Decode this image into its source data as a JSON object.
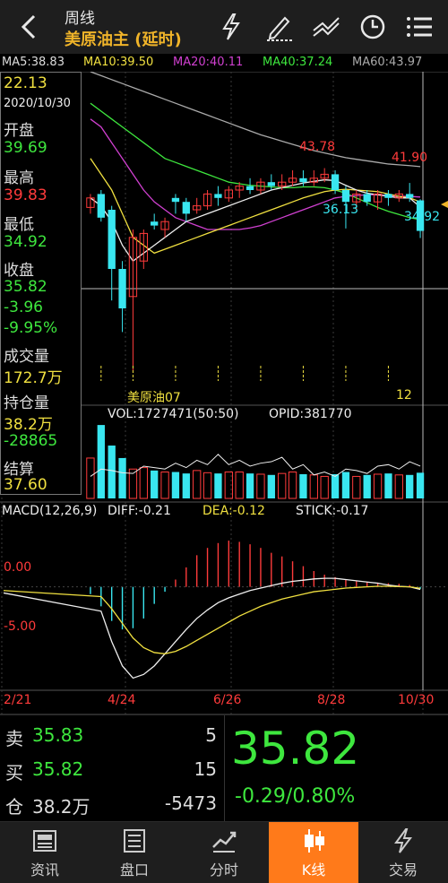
{
  "header": {
    "period": "周线",
    "instrument": "美原油主 (延时)",
    "icons": [
      "lightning-icon",
      "draw-pen-icon",
      "indicator-icon",
      "clock-icon",
      "menu-icon"
    ]
  },
  "ma_line": {
    "items": [
      {
        "text": "MA5:38.83",
        "color": "#dddddd"
      },
      {
        "text": "MA10:39.50",
        "color": "#f0e040"
      },
      {
        "text": "MA20:40.11",
        "color": "#d040d0"
      },
      {
        "text": "MA40:37.24",
        "color": "#3ee73e"
      },
      {
        "text": "MA60:43.97",
        "color": "#aaaaaa"
      }
    ]
  },
  "info_panel": {
    "value_top": "22.13",
    "date": "2020/10/30",
    "open_label": "开盘",
    "open": "39.69",
    "high_label": "最高",
    "high": "39.83",
    "low_label": "最低",
    "low": "34.92",
    "close_label": "收盘",
    "close": "35.82",
    "change": "-3.96",
    "change_pct": "-9.95%",
    "volume_label": "成交量",
    "volume": "172.7万",
    "oi_label": "持仓量",
    "oi": "38.2万",
    "oi_change": "-28865",
    "settle_label": "结算",
    "settle": "37.60"
  },
  "chart_labels": {
    "peak1": "43.78",
    "peak2": "41.90",
    "trough1": "36.13",
    "last_low": "34.92",
    "contract_label": "美原油07",
    "month_mark": "12"
  },
  "volume_line": {
    "vol": "VOL:1727471(50:50)",
    "opid": "OPID:381770"
  },
  "macd_line": {
    "title": "MACD(12,26,9)",
    "diff": "DIFF:-0.21",
    "dea": "DEA:-0.12",
    "stick": "STICK:-0.17",
    "zero": "0.00",
    "minus5": "-5.00"
  },
  "x_axis": [
    "2/21",
    "4/24",
    "6/26",
    "8/28",
    "10/30"
  ],
  "chart_data": {
    "type": "candlestick",
    "candles": [
      {
        "o": 38.8,
        "c": 40.0,
        "h": 40.5,
        "l": 38.0
      },
      {
        "o": 40.5,
        "c": 37.5,
        "h": 41.0,
        "l": 37.0
      },
      {
        "o": 38.5,
        "c": 31.0,
        "h": 39.0,
        "l": 27.0
      },
      {
        "o": 31.0,
        "c": 26.0,
        "h": 32.0,
        "l": 23.0
      },
      {
        "o": 27.5,
        "c": 35.0,
        "h": 36.0,
        "l": 18.0
      },
      {
        "o": 32.0,
        "c": 35.5,
        "h": 36.0,
        "l": 31.0
      },
      {
        "o": 37.0,
        "c": 36.5,
        "h": 38.0,
        "l": 36.0
      },
      {
        "o": 36.0,
        "c": 37.0,
        "h": 37.5,
        "l": 35.0
      },
      {
        "o": 40.0,
        "c": 39.5,
        "h": 40.5,
        "l": 38.0
      },
      {
        "o": 39.5,
        "c": 38.0,
        "h": 40.0,
        "l": 37.0
      },
      {
        "o": 38.5,
        "c": 39.0,
        "h": 40.0,
        "l": 38.0
      },
      {
        "o": 39.0,
        "c": 40.5,
        "h": 41.0,
        "l": 38.5
      },
      {
        "o": 40.5,
        "c": 40.0,
        "h": 41.5,
        "l": 39.0
      },
      {
        "o": 40.0,
        "c": 41.0,
        "h": 41.5,
        "l": 39.5
      },
      {
        "o": 41.0,
        "c": 41.5,
        "h": 42.0,
        "l": 40.0
      },
      {
        "o": 41.5,
        "c": 41.0,
        "h": 42.5,
        "l": 40.5
      },
      {
        "o": 41.0,
        "c": 42.0,
        "h": 42.5,
        "l": 40.5
      },
      {
        "o": 42.0,
        "c": 41.5,
        "h": 43.0,
        "l": 41.0
      },
      {
        "o": 41.5,
        "c": 42.0,
        "h": 43.0,
        "l": 41.0
      },
      {
        "o": 42.0,
        "c": 42.5,
        "h": 43.5,
        "l": 41.5
      },
      {
        "o": 42.5,
        "c": 42.0,
        "h": 43.5,
        "l": 41.5
      },
      {
        "o": 42.0,
        "c": 42.5,
        "h": 43.5,
        "l": 41.5
      },
      {
        "o": 42.5,
        "c": 43.0,
        "h": 43.78,
        "l": 42.0
      },
      {
        "o": 43.0,
        "c": 41.0,
        "h": 43.5,
        "l": 40.5
      },
      {
        "o": 41.0,
        "c": 39.5,
        "h": 41.5,
        "l": 36.13
      },
      {
        "o": 39.5,
        "c": 40.5,
        "h": 41.0,
        "l": 38.5
      },
      {
        "o": 40.5,
        "c": 39.5,
        "h": 41.0,
        "l": 39.0
      },
      {
        "o": 39.5,
        "c": 40.5,
        "h": 41.0,
        "l": 38.5
      },
      {
        "o": 40.5,
        "c": 40.0,
        "h": 41.0,
        "l": 39.0
      },
      {
        "o": 40.0,
        "c": 40.5,
        "h": 41.0,
        "l": 39.5
      },
      {
        "o": 40.5,
        "c": 40.0,
        "h": 41.9,
        "l": 39.5
      },
      {
        "o": 39.69,
        "c": 35.82,
        "h": 39.83,
        "l": 34.92
      }
    ],
    "ma5": [
      40,
      39,
      37,
      34,
      32,
      33,
      34,
      35,
      36,
      37,
      37.5,
      38,
      38.5,
      39,
      39.5,
      40,
      40.5,
      41,
      41.3,
      41.6,
      41.9,
      42.1,
      42.3,
      42.2,
      41.6,
      41,
      40.6,
      40.4,
      40.2,
      40,
      40,
      38.83
    ],
    "ma10": [
      45,
      43,
      41,
      38,
      35,
      34,
      33,
      33.5,
      34,
      34.5,
      35,
      35.5,
      36,
      36.5,
      37,
      37.5,
      38,
      38.5,
      39,
      39.5,
      40,
      40.4,
      40.8,
      41,
      41.1,
      41,
      40.9,
      40.8,
      40.5,
      40.2,
      40,
      39.5
    ],
    "ma20": [
      50,
      49,
      47,
      45,
      43,
      41,
      39.5,
      38.5,
      37.5,
      37,
      36.5,
      36,
      36,
      36,
      36,
      36.2,
      36.5,
      37,
      37.5,
      38,
      38.5,
      39,
      39.5,
      40,
      40.2,
      40.3,
      40.4,
      40.4,
      40.3,
      40.2,
      40.2,
      40.11
    ],
    "ma40": [
      52,
      51,
      50,
      49,
      48,
      47,
      46,
      45,
      44.5,
      44,
      43.5,
      43,
      42.5,
      42,
      41.8,
      41.6,
      41.5,
      41.4,
      41.3,
      41.3,
      41.4,
      41.4,
      41.3,
      41,
      40.6,
      40,
      39.4,
      38.8,
      38.3,
      37.9,
      37.5,
      37.24
    ],
    "ma60": [
      56,
      55.5,
      55,
      54.5,
      54,
      53.5,
      53,
      52.5,
      52,
      51.5,
      51,
      50.5,
      50,
      49.5,
      49,
      48.5,
      48,
      47.6,
      47.2,
      46.8,
      46.4,
      46,
      45.7,
      45.4,
      45.1,
      44.9,
      44.7,
      44.5,
      44.3,
      44.2,
      44.1,
      43.97
    ],
    "volume": [
      55,
      100,
      72,
      55,
      40,
      42,
      38,
      36,
      36,
      34,
      38,
      35,
      34,
      36,
      36,
      34,
      33,
      32,
      34,
      36,
      33,
      32,
      30,
      33,
      36,
      30,
      32,
      33,
      34,
      32,
      32,
      35
    ],
    "oi_line": [
      30,
      40,
      38,
      35,
      34,
      44,
      42,
      40,
      48,
      42,
      52,
      46,
      60,
      46,
      52,
      44,
      48,
      50,
      56,
      40,
      46,
      32,
      36,
      30,
      40,
      38,
      34,
      44,
      46,
      40,
      50,
      44
    ],
    "macd_hist": [
      -0.6,
      -1.6,
      -2.8,
      -3.5,
      -3.4,
      -2.6,
      -1.4,
      -0.4,
      0.6,
      1.6,
      2.6,
      3.2,
      3.6,
      3.8,
      3.7,
      3.5,
      3.2,
      2.8,
      2.5,
      2.1,
      1.7,
      1.3,
      1.0,
      0.8,
      0.6,
      0.5,
      0.4,
      0.35,
      0.3,
      0.25,
      0.15,
      -0.17
    ],
    "diff": [
      -0.5,
      -2,
      -4.5,
      -6.5,
      -7.5,
      -7.2,
      -6.5,
      -5.5,
      -4.5,
      -3.5,
      -2.6,
      -1.9,
      -1.3,
      -0.9,
      -0.6,
      -0.3,
      -0.1,
      0.1,
      0.3,
      0.45,
      0.55,
      0.65,
      0.7,
      0.7,
      0.6,
      0.5,
      0.4,
      0.3,
      0.15,
      0.05,
      0,
      -0.21
    ],
    "dea": [
      -0.3,
      -0.8,
      -1.8,
      -3,
      -4.2,
      -5,
      -5.4,
      -5.5,
      -5.3,
      -4.9,
      -4.4,
      -3.9,
      -3.4,
      -2.9,
      -2.4,
      -2,
      -1.6,
      -1.3,
      -1,
      -0.8,
      -0.6,
      -0.4,
      -0.3,
      -0.2,
      -0.1,
      -0.05,
      0,
      0.05,
      0.05,
      0.02,
      0,
      -0.12
    ],
    "price_range": [
      16,
      56
    ],
    "macd_range": [
      -8.5,
      5.5
    ]
  },
  "quote": {
    "sell_label": "卖",
    "sell_price": "35.83",
    "sell_qty": "5",
    "buy_label": "买",
    "buy_price": "35.82",
    "buy_qty": "15",
    "oi_label": "仓",
    "oi_value": "38.2万",
    "oi_change": "-5473",
    "last_price": "35.82",
    "change": "-0.29/0.80%"
  },
  "tabs": [
    {
      "label": "资讯",
      "icon": "news-icon"
    },
    {
      "label": "盘口",
      "icon": "orderbook-icon"
    },
    {
      "label": "分时",
      "icon": "timeshare-icon"
    },
    {
      "label": "K线",
      "icon": "candlestick-icon",
      "active": true
    },
    {
      "label": "交易",
      "icon": "lightning-icon"
    }
  ],
  "colors": {
    "up": "#ff3b3b",
    "down": "#39e6f0",
    "accent": "#ff7a1a",
    "green": "#3ee73e",
    "yellow": "#f0e040"
  }
}
